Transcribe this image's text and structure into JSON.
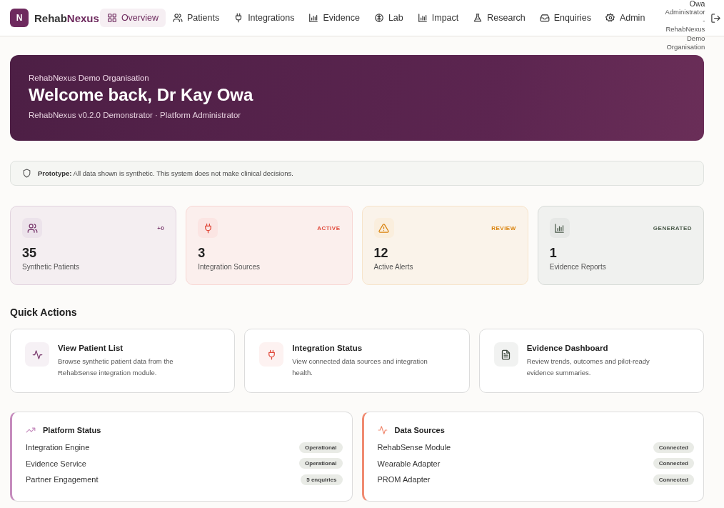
{
  "brand": {
    "logo": "N",
    "name_prefix": "Rehab",
    "name_suffix": "Nexus"
  },
  "nav": [
    {
      "label": "Overview",
      "selected": true
    },
    {
      "label": "Patients",
      "selected": false
    },
    {
      "label": "Integrations",
      "selected": false
    },
    {
      "label": "Evidence",
      "selected": false
    },
    {
      "label": "Lab",
      "selected": false
    },
    {
      "label": "Impact",
      "selected": false
    },
    {
      "label": "Research",
      "selected": false
    },
    {
      "label": "Enquiries",
      "selected": false
    },
    {
      "label": "Admin",
      "selected": false
    }
  ],
  "user": {
    "lines": [
      "Owa",
      "Administrator",
      "-",
      "RehabNexus",
      "Demo",
      "Organisation"
    ]
  },
  "hero": {
    "org": "RehabNexus Demo Organisation",
    "title": "Welcome back, Dr Kay Owa",
    "subtitle": "RehabNexus v0.2.0 Demonstrator · Platform Administrator"
  },
  "notice": {
    "text": "**Prototype:** All data shown is synthetic. This system does not make clinical decisions."
  },
  "stats": [
    {
      "kind": "users",
      "color": "#7a3a6e",
      "badge": "+0",
      "value": "35",
      "label": "Synthetic Patients"
    },
    {
      "kind": "plug",
      "color": "#e0483a",
      "badge": "ACTIVE",
      "value": "3",
      "label": "Integration Sources"
    },
    {
      "kind": "alert",
      "color": "#d9820c",
      "badge": "REVIEW",
      "value": "12",
      "label": "Active Alerts"
    },
    {
      "kind": "chart",
      "color": "#4a5a4a",
      "badge": "GENERATED",
      "value": "1",
      "label": "Evidence Reports"
    }
  ],
  "quick_actions": {
    "title": "Quick Actions",
    "items": [
      {
        "kind": "pulse",
        "color": "#7a3a6e",
        "title": "View Patient List",
        "description": "Browse synthetic patient data from the RehabSense integration module."
      },
      {
        "kind": "plug",
        "color": "#e0483a",
        "title": "Integration Status",
        "description": "View connected data sources and integration health."
      },
      {
        "kind": "doc",
        "color": "#3d4a3d",
        "title": "Evidence Dashboard",
        "description": "Review trends, outcomes and pilot-ready evidence summaries."
      }
    ]
  },
  "panels": [
    {
      "kind": "trend",
      "color": "#c58bbd",
      "title": "Platform Status",
      "rows": [
        {
          "label": "Integration Engine",
          "status": "Operational"
        },
        {
          "label": "Evidence Service",
          "status": "Operational"
        },
        {
          "label": "Partner Engagement",
          "status": "5 enquiries"
        }
      ]
    },
    {
      "kind": "pulse",
      "color": "#f08a70",
      "title": "Data Sources",
      "rows": [
        {
          "label": "RehabSense Module",
          "status": "Connected"
        },
        {
          "label": "Wearable Adapter",
          "status": "Connected"
        },
        {
          "label": "PROM Adapter",
          "status": "Connected"
        }
      ]
    }
  ]
}
